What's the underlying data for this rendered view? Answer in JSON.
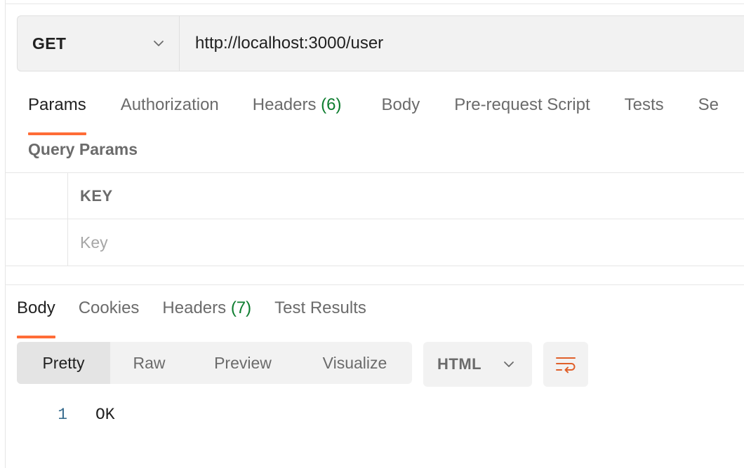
{
  "request": {
    "method": "GET",
    "url": "http://localhost:3000/user",
    "tabs": [
      {
        "label": "Params",
        "count": null,
        "active": true
      },
      {
        "label": "Authorization",
        "count": null,
        "active": false
      },
      {
        "label": "Headers",
        "count": "(6)",
        "active": false
      },
      {
        "label": "Body",
        "count": null,
        "active": false
      },
      {
        "label": "Pre-request Script",
        "count": null,
        "active": false
      },
      {
        "label": "Tests",
        "count": null,
        "active": false
      },
      {
        "label": "Se",
        "count": null,
        "active": false
      }
    ],
    "query_params_title": "Query Params",
    "table": {
      "key_header": "KEY",
      "key_placeholder": "Key"
    }
  },
  "response": {
    "tabs": [
      {
        "label": "Body",
        "count": null,
        "active": true
      },
      {
        "label": "Cookies",
        "count": null,
        "active": false
      },
      {
        "label": "Headers",
        "count": "(7)",
        "active": false
      },
      {
        "label": "Test Results",
        "count": null,
        "active": false
      }
    ],
    "views": [
      "Pretty",
      "Raw",
      "Preview",
      "Visualize"
    ],
    "active_view": "Pretty",
    "format": "HTML",
    "lines": [
      {
        "number": "1",
        "text": "OK"
      }
    ]
  },
  "icons": {
    "method_dropdown": "chevron-down-icon",
    "format_dropdown": "chevron-down-icon",
    "wrap": "wrap-lines-icon"
  },
  "colors": {
    "accent": "#ff6c37",
    "count": "#0d7d2f",
    "line_number": "#3a6e8f"
  }
}
